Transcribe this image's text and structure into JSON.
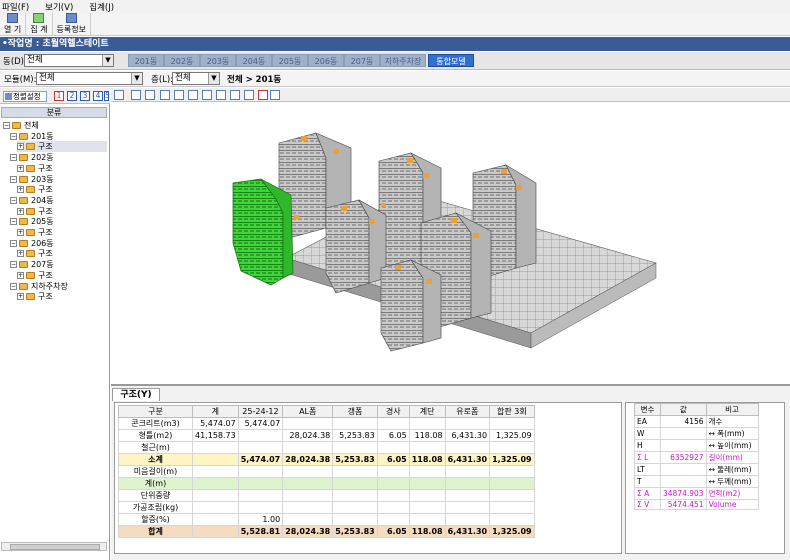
{
  "menu": [
    "파일(F)",
    "보기(V)",
    "집계(J)"
  ],
  "toolbar": {
    "buttons": [
      "열 기",
      "집 계",
      "등록정보"
    ]
  },
  "title": "•작업명 : 초월역헬스테이트",
  "dong": {
    "label": "동(D):",
    "value": "전체",
    "tabs": [
      "201동",
      "202동",
      "203동",
      "204동",
      "205동",
      "206동",
      "207동",
      "지하주차장",
      "통합모델"
    ],
    "active_tab": "통합모델"
  },
  "module": {
    "label": "모듈(M):",
    "value": "전체",
    "floor_label": "층(L):",
    "floor_value": "전체",
    "breadcrumb": "전체 > 201동"
  },
  "tree": {
    "settings_label": "정렬설정",
    "numbers": [
      "1",
      "2",
      "3",
      "4",
      "5"
    ],
    "header": "분류",
    "items": [
      {
        "label": "전체",
        "level": 0
      },
      {
        "label": "201동",
        "level": 1
      },
      {
        "label": "구조",
        "level": 2
      },
      {
        "label": "202동",
        "level": 1
      },
      {
        "label": "구조",
        "level": 2
      },
      {
        "label": "203동",
        "level": 1
      },
      {
        "label": "구조",
        "level": 2
      },
      {
        "label": "204동",
        "level": 1
      },
      {
        "label": "구조",
        "level": 2
      },
      {
        "label": "205동",
        "level": 1
      },
      {
        "label": "구조",
        "level": 2
      },
      {
        "label": "206동",
        "level": 1
      },
      {
        "label": "구조",
        "level": 2
      },
      {
        "label": "207동",
        "level": 1
      },
      {
        "label": "구조",
        "level": 2
      },
      {
        "label": "지하주차장",
        "level": 1
      },
      {
        "label": "구조",
        "level": 2
      }
    ]
  },
  "bottom_tab": "구조(Y)",
  "grid": {
    "headers": [
      "구분",
      "계",
      "25-24-12",
      "AL폼",
      "갱폼",
      "경사",
      "계단",
      "유로폼",
      "합판 3회"
    ],
    "rows": [
      {
        "cells": [
          "콘크리트(m3)",
          "5,474.07",
          "5,474.07",
          "",
          "",
          "",
          "",
          "",
          ""
        ],
        "style": ""
      },
      {
        "cells": [
          "형틀(m2)",
          "41,158.73",
          "",
          "28,024.38",
          "5,253.83",
          "6.05",
          "118.08",
          "6,431.30",
          "1,325.09"
        ],
        "style": ""
      },
      {
        "cells": [
          "철근(m)",
          "",
          "",
          "",
          "",
          "",
          "",
          "",
          ""
        ],
        "style": ""
      },
      {
        "cells": [
          "소계",
          "",
          "5,474.07",
          "28,024.38",
          "5,253.83",
          "6.05",
          "118.08",
          "6,431.30",
          "1,325.09"
        ],
        "style": "yel"
      },
      {
        "cells": [
          "미음걸이(m)",
          "",
          "",
          "",
          "",
          "",
          "",
          "",
          ""
        ],
        "style": ""
      },
      {
        "cells": [
          "계(m)",
          "",
          "",
          "",
          "",
          "",
          "",
          "",
          ""
        ],
        "style": "grn"
      },
      {
        "cells": [
          "단위중량",
          "",
          "",
          "",
          "",
          "",
          "",
          "",
          ""
        ],
        "style": ""
      },
      {
        "cells": [
          "가공조립(kg)",
          "",
          "",
          "",
          "",
          "",
          "",
          "",
          ""
        ],
        "style": ""
      },
      {
        "cells": [
          "할증(%)",
          "",
          "1.00",
          "",
          "",
          "",
          "",
          "",
          ""
        ],
        "style": ""
      },
      {
        "cells": [
          "합계",
          "",
          "5,528.81",
          "28,024.38",
          "5,253.83",
          "6.05",
          "118.08",
          "6,431.30",
          "1,325.09"
        ],
        "style": "org"
      }
    ]
  },
  "vars": {
    "headers": [
      "변수",
      "값",
      "비고"
    ],
    "rows": [
      {
        "name": "EA",
        "value": "4156",
        "note": "개수",
        "mag": false
      },
      {
        "name": "W",
        "value": "",
        "note": "↔ 폭(mm)",
        "mag": false
      },
      {
        "name": "H",
        "value": "",
        "note": "↔ 높이(mm)",
        "mag": false
      },
      {
        "name": "Σ L",
        "value": "6352927",
        "note": "길이(mm)",
        "mag": true
      },
      {
        "name": "LT",
        "value": "",
        "note": "↔ 둘레(mm)",
        "mag": false
      },
      {
        "name": "T",
        "value": "",
        "note": "↔ 두께(mm)",
        "mag": false
      },
      {
        "name": "Σ A",
        "value": "34874.903",
        "note": "면적(m2)",
        "mag": true
      },
      {
        "name": "Σ V",
        "value": "5474.451",
        "note": "Volume",
        "mag": true
      }
    ]
  }
}
